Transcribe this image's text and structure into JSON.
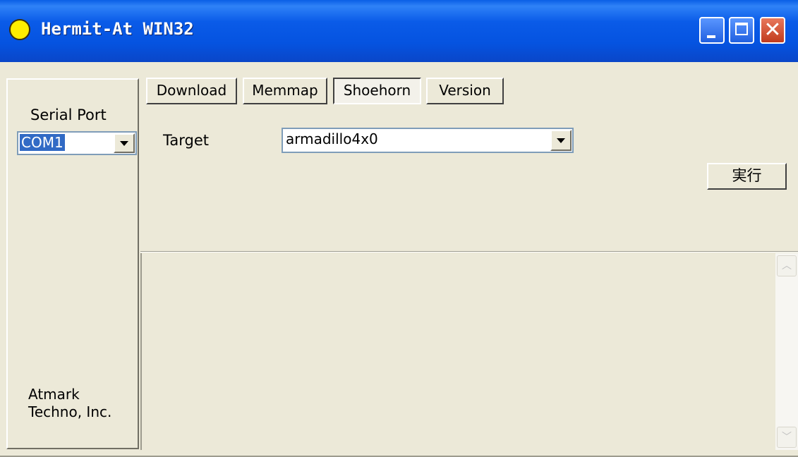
{
  "window": {
    "title": "Hermit-At WIN32",
    "icon": "yellow-circle-icon",
    "controls": [
      "minimize-icon",
      "maximize-icon",
      "close-icon"
    ],
    "close_glyph": "✕"
  },
  "left_panel": {
    "serial_port_label": "Serial Port",
    "serial_port_value": "COM1",
    "company_line1": "Atmark",
    "company_line2": "Techno, Inc."
  },
  "tabs": [
    {
      "label": "Download",
      "active": false
    },
    {
      "label": "Memmap",
      "active": false
    },
    {
      "label": "Shoehorn",
      "active": true
    },
    {
      "label": "Version",
      "active": false
    }
  ],
  "shoehorn": {
    "target_label": "Target",
    "target_value": "armadillo4x0",
    "run_button": "実行"
  },
  "output": {
    "scroll_up": "︿",
    "scroll_down": "﹀"
  },
  "colors": {
    "titlebar": "#0553e0",
    "face": "#ece9d8",
    "selection": "#316ac5",
    "close_button": "#c13b1d"
  }
}
